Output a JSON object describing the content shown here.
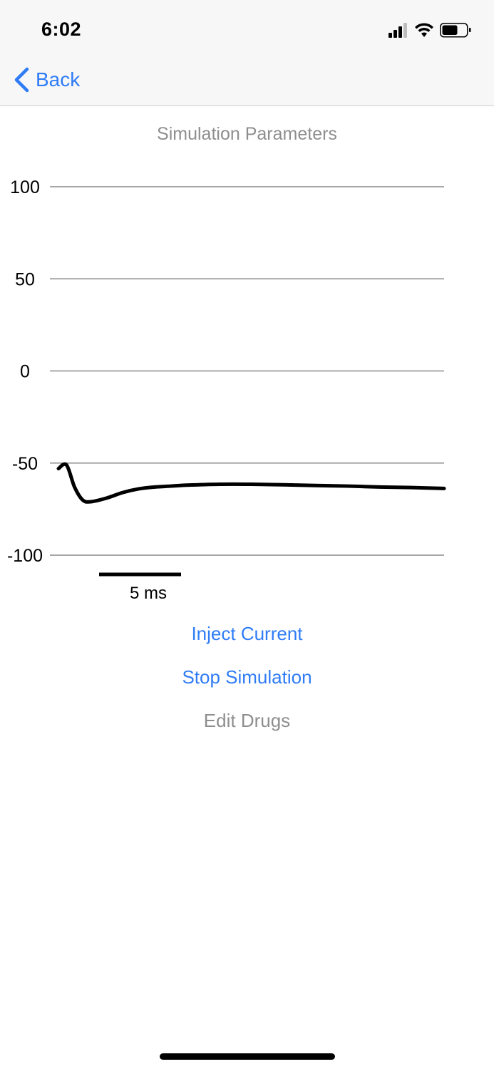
{
  "status_bar": {
    "time": "6:02",
    "icons": [
      "cellular-signal-icon",
      "wifi-icon",
      "battery-icon"
    ]
  },
  "nav": {
    "back_label": "Back"
  },
  "section_title": "Simulation Parameters",
  "chart_data": {
    "type": "line",
    "y_ticks": [
      "100",
      "50",
      "0",
      "-50",
      "-100"
    ],
    "ylim": [
      -100,
      100
    ],
    "grid": true,
    "scale_bar_label": "5 ms",
    "series": [
      {
        "x": [
          0,
          0.5,
          1,
          1.5,
          2,
          3,
          4,
          5,
          6,
          7,
          8,
          10,
          12,
          14,
          16,
          18,
          20,
          22,
          24
        ],
        "values": [
          -53,
          -51,
          -63,
          -70,
          -71,
          -69,
          -66,
          -64,
          -63,
          -62.5,
          -62,
          -61.5,
          -61.5,
          -61.8,
          -62.2,
          -62.5,
          -63,
          -63.3,
          -63.8
        ]
      }
    ],
    "xlim": [
      0,
      24
    ],
    "color": "#000000"
  },
  "actions": {
    "inject_current": "Inject Current",
    "stop_simulation": "Stop Simulation",
    "edit_drugs": "Edit Drugs"
  },
  "colors": {
    "accent": "#2f7cf6",
    "disabled": "#8e8e8e"
  }
}
